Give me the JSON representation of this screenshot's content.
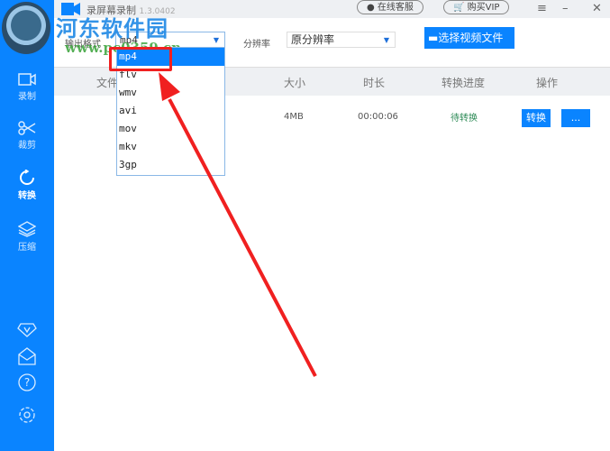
{
  "app": {
    "title": "录屏幕录制",
    "version": "1.3.0402",
    "support": "在线客服",
    "buy_vip": "购买VIP"
  },
  "watermark": {
    "name": "河东软件园",
    "url": "www.pc0359.cn"
  },
  "sidebar": {
    "items": [
      {
        "label": "录制"
      },
      {
        "label": "裁剪"
      },
      {
        "label": "转换"
      },
      {
        "label": "压缩"
      }
    ]
  },
  "toolbar": {
    "format_label": "输出格式",
    "format_value": "mp4",
    "resolution_label": "分辨率",
    "resolution_value": "原分辨率",
    "choose_file": "选择视频文件"
  },
  "format_options": [
    "mp4",
    "flv",
    "wmv",
    "avi",
    "mov",
    "mkv",
    "3gp"
  ],
  "table": {
    "headers": [
      "文件",
      "大小",
      "时长",
      "转换进度",
      "操作"
    ],
    "rows": [
      {
        "size": "4MB",
        "duration": "00:00:06",
        "status": "待转换",
        "convert": "转换",
        "more": "..."
      }
    ]
  },
  "colors": {
    "accent": "#0a84ff",
    "highlight": "#f02020",
    "status": "#2e8b57"
  }
}
